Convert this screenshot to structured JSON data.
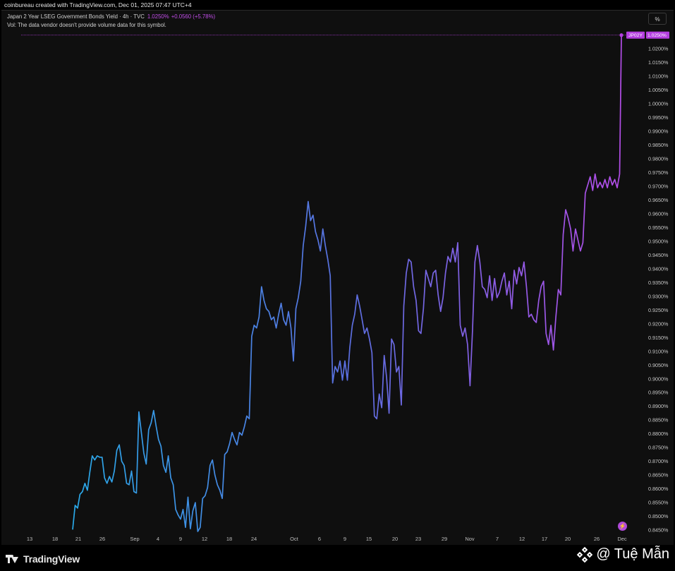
{
  "attribution": "coinbureau created with TradingView.com, Dec 01, 2025 07:47 UTC+4",
  "legend": {
    "title": "Japan 2 Year LSEG Government Bonds Yield · 4h · TVC",
    "price": "1.0250%",
    "change": "+0.0560 (+5.78%)",
    "volume_note": "Vol: The data vendor doesn't provide volume data for this symbol."
  },
  "percent_button": "%",
  "price_tag": {
    "symbol": "JP02Y",
    "value": "1.0250%"
  },
  "branding": {
    "logo_text": "TradingView",
    "watermark": "@ Tuệ Mẫn"
  },
  "icons": {
    "logo": "tradingview-logo-icon",
    "watermark": "binance-icon",
    "flash": "lightning-icon"
  },
  "colors": {
    "line_start": "#29a9e8",
    "line_mid": "#5b6fe0",
    "line_end": "#b44de8",
    "price_tag": "#b43fe0"
  },
  "chart_data": {
    "type": "line",
    "title": "Japan 2 Year LSEG Government Bonds Yield · 4h · TVC",
    "ylabel": "",
    "xlabel": "",
    "ylim": [
      0.8445,
      1.0275
    ],
    "y_ticks": [
      "1.0200%",
      "1.0150%",
      "1.0100%",
      "1.0050%",
      "1.0000%",
      "0.9950%",
      "0.9900%",
      "0.9850%",
      "0.9800%",
      "0.9750%",
      "0.9700%",
      "0.9650%",
      "0.9600%",
      "0.9550%",
      "0.9500%",
      "0.9450%",
      "0.9400%",
      "0.9350%",
      "0.9300%",
      "0.9250%",
      "0.9200%",
      "0.9150%",
      "0.9100%",
      "0.9050%",
      "0.9000%",
      "0.8950%",
      "0.8900%",
      "0.8850%",
      "0.8800%",
      "0.8750%",
      "0.8700%",
      "0.8650%",
      "0.8600%",
      "0.8550%",
      "0.8500%",
      "0.8450%"
    ],
    "x_ticks": [
      "13",
      "18",
      "21",
      "26",
      "Sep",
      "4",
      "9",
      "12",
      "18",
      "24",
      "Oct",
      "6",
      "9",
      "15",
      "20",
      "23",
      "29",
      "Nov",
      "7",
      "12",
      "17",
      "20",
      "26",
      "Dec"
    ],
    "grid": false,
    "series": [
      {
        "values": [
          0.8452,
          0.854,
          0.853,
          0.858,
          0.859,
          0.862,
          0.8595,
          0.866,
          0.872,
          0.8705,
          0.872,
          0.8715,
          0.8715,
          0.864,
          0.862,
          0.8645,
          0.8625,
          0.8665,
          0.874,
          0.876,
          0.87,
          0.8685,
          0.862,
          0.8615,
          0.8665,
          0.859,
          0.8585,
          0.888,
          0.8805,
          0.873,
          0.869,
          0.8815,
          0.884,
          0.8885,
          0.883,
          0.878,
          0.8755,
          0.8685,
          0.866,
          0.872,
          0.864,
          0.8615,
          0.8525,
          0.8505,
          0.849,
          0.8525,
          0.846,
          0.857,
          0.8455,
          0.852,
          0.855,
          0.8445,
          0.846,
          0.8565,
          0.8575,
          0.8605,
          0.8685,
          0.8705,
          0.865,
          0.8615,
          0.8595,
          0.8565,
          0.8725,
          0.8735,
          0.8765,
          0.8805,
          0.878,
          0.876,
          0.8805,
          0.8795,
          0.8825,
          0.8865,
          0.8855,
          0.9155,
          0.9195,
          0.9185,
          0.9225,
          0.9335,
          0.9285,
          0.9255,
          0.9245,
          0.9215,
          0.9225,
          0.9185,
          0.9235,
          0.9275,
          0.9215,
          0.9195,
          0.9245,
          0.9185,
          0.9065,
          0.9255,
          0.9295,
          0.9355,
          0.9485,
          0.9555,
          0.9645,
          0.9575,
          0.9595,
          0.9535,
          0.9505,
          0.9465,
          0.9545,
          0.9485,
          0.9435,
          0.9375,
          0.8985,
          0.9045,
          0.9025,
          0.9065,
          0.8995,
          0.9065,
          0.8995,
          0.9115,
          0.9195,
          0.9235,
          0.9305,
          0.9265,
          0.9215,
          0.9165,
          0.9185,
          0.9145,
          0.9095,
          0.8865,
          0.8855,
          0.8945,
          0.8895,
          0.9085,
          0.9005,
          0.8875,
          0.9145,
          0.9125,
          0.9025,
          0.9045,
          0.8905,
          0.9265,
          0.9385,
          0.9435,
          0.9425,
          0.9335,
          0.9285,
          0.9175,
          0.9165,
          0.9255,
          0.9395,
          0.9365,
          0.9335,
          0.9385,
          0.9395,
          0.9305,
          0.9245,
          0.9295,
          0.9385,
          0.9445,
          0.9425,
          0.9475,
          0.9425,
          0.9495,
          0.9195,
          0.9155,
          0.9185,
          0.9125,
          0.8975,
          0.9175,
          0.9425,
          0.9485,
          0.9425,
          0.9335,
          0.9325,
          0.9295,
          0.9375,
          0.9285,
          0.9365,
          0.9295,
          0.9315,
          0.9355,
          0.9385,
          0.9305,
          0.9355,
          0.9255,
          0.9395,
          0.9345,
          0.9405,
          0.9375,
          0.9425,
          0.9335,
          0.9225,
          0.9235,
          0.9215,
          0.9205,
          0.9285,
          0.9335,
          0.9355,
          0.9165,
          0.9125,
          0.9195,
          0.9105,
          0.9225,
          0.9325,
          0.9305,
          0.9525,
          0.9615,
          0.9585,
          0.9545,
          0.9465,
          0.9545,
          0.9505,
          0.9465,
          0.9495,
          0.9675,
          0.9705,
          0.9735,
          0.9685,
          0.9745,
          0.9695,
          0.9715,
          0.9695,
          0.9725,
          0.9695,
          0.9735,
          0.9705,
          0.9725,
          0.9695,
          0.9745,
          1.025
        ]
      }
    ]
  }
}
